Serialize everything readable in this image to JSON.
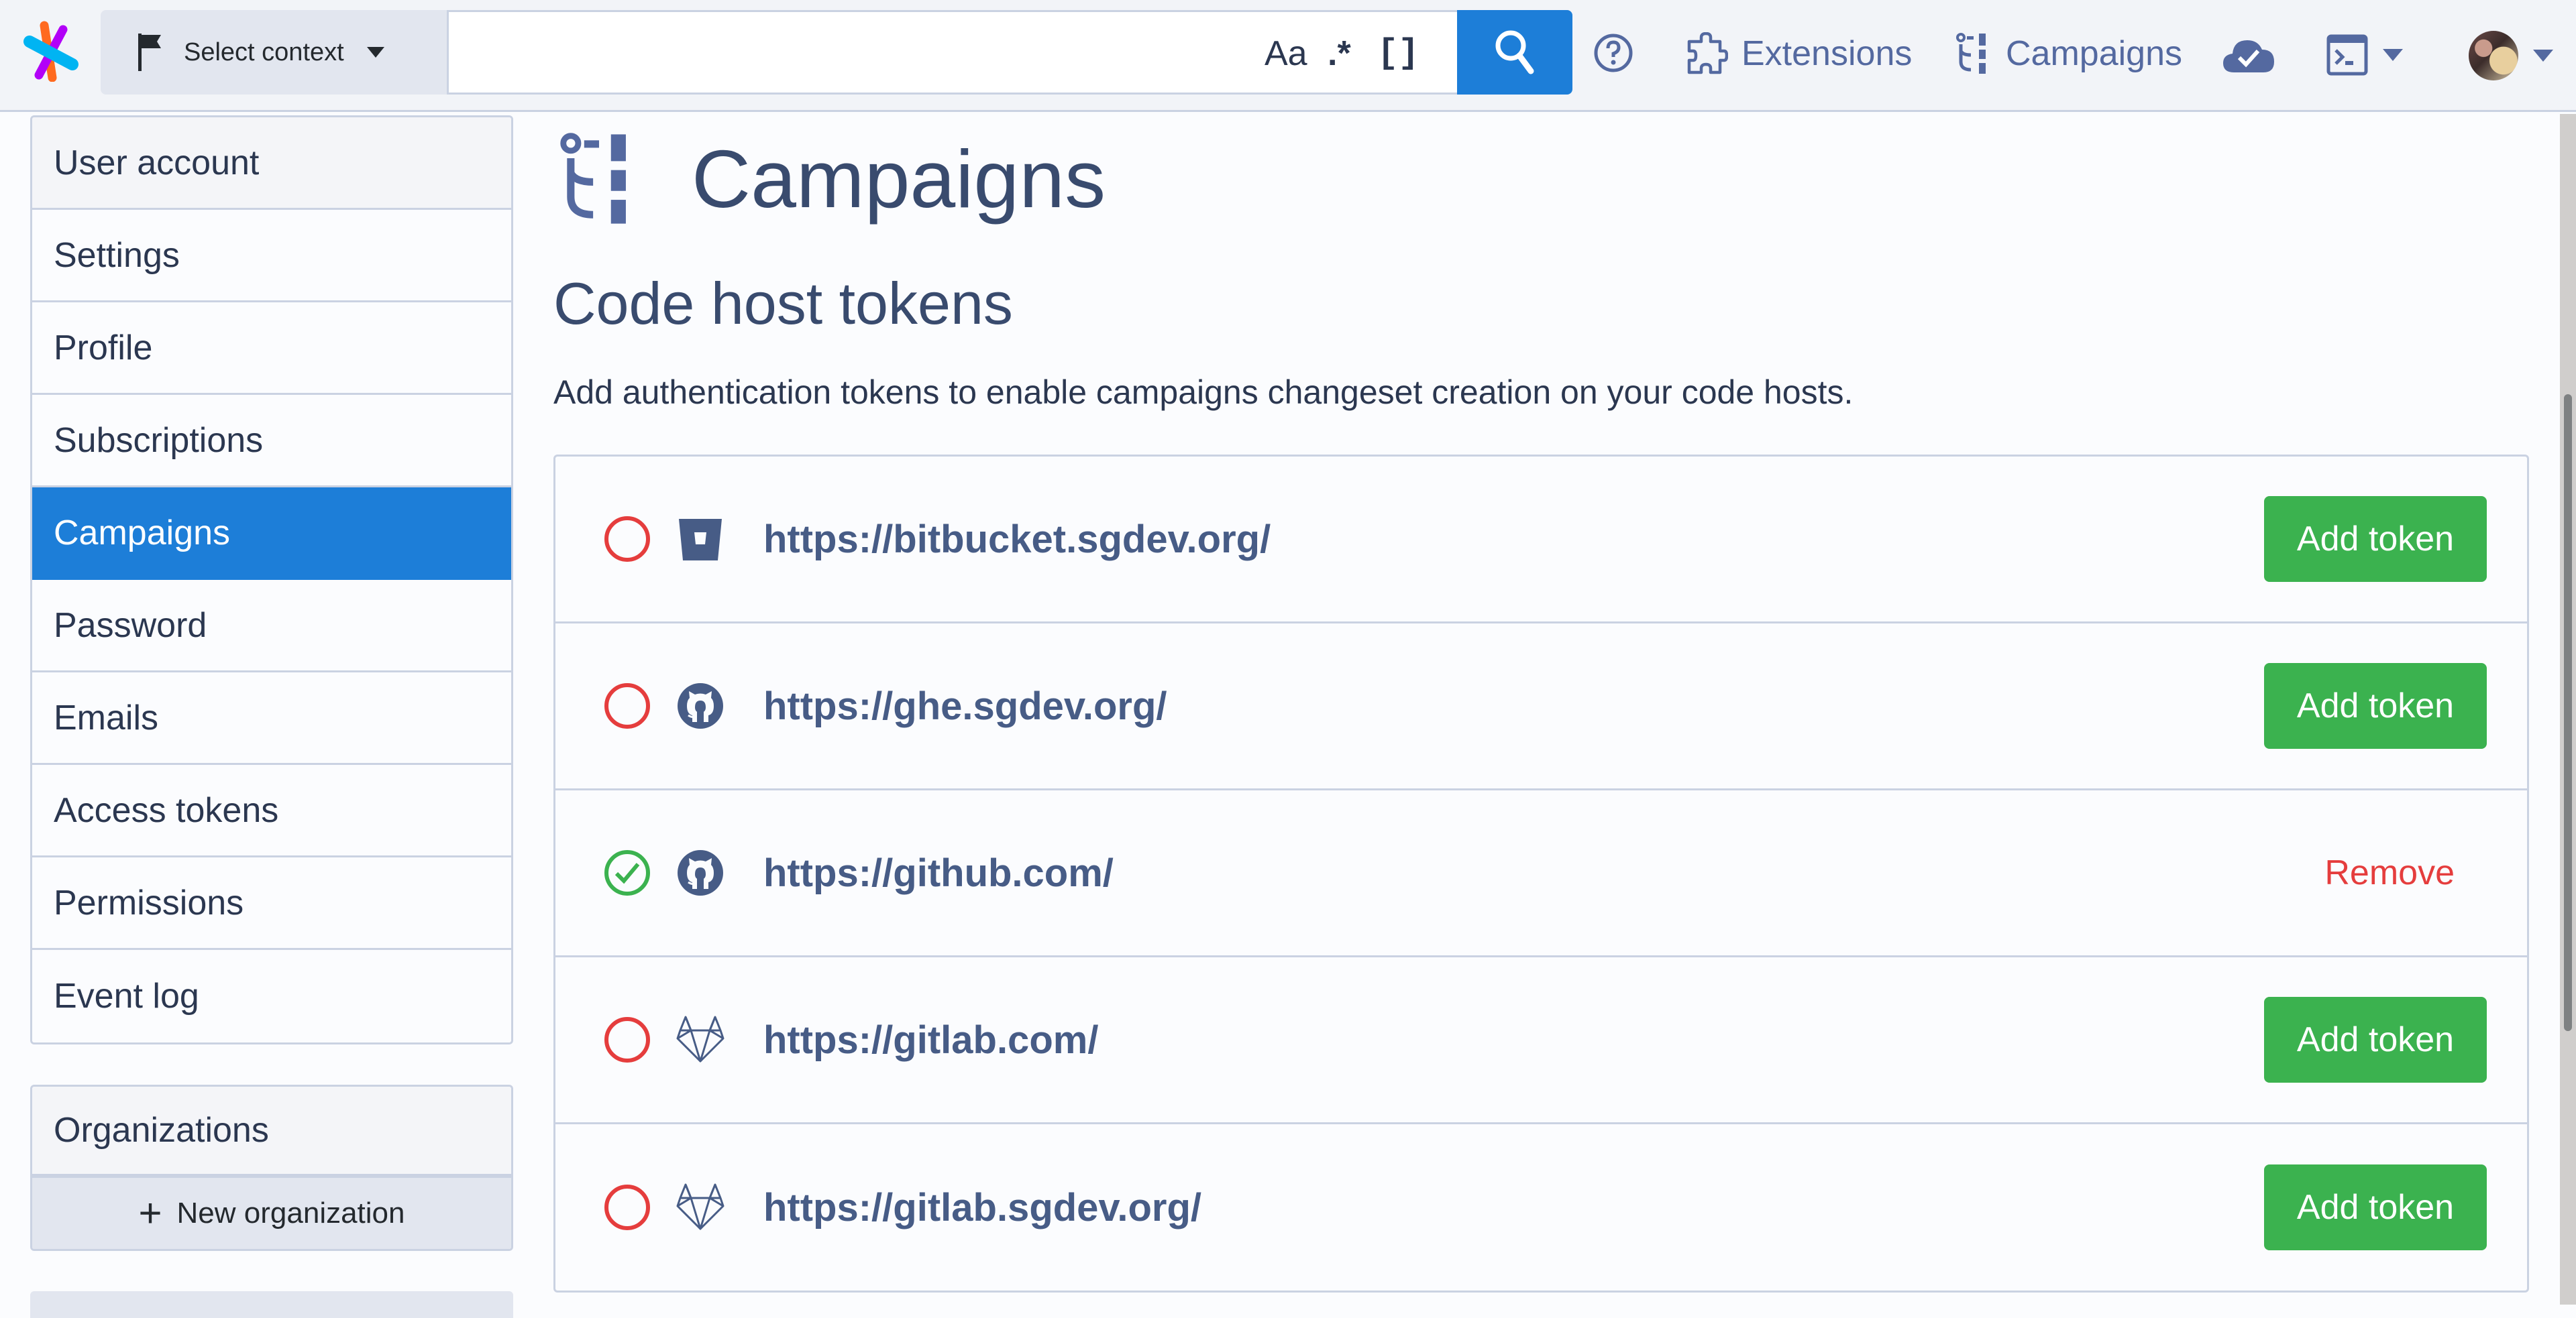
{
  "navbar": {
    "logo_icon": "sourcegraph-logo-icon",
    "context_selector": {
      "label": "Select context",
      "icon": "flag-icon"
    },
    "search": {
      "value": "",
      "placeholder": "",
      "toggles": {
        "case_sensitive": "Aa",
        "regexp": ".*",
        "structural": "[]"
      },
      "submit_icon": "search-icon"
    },
    "help_icon": "help-circle-icon",
    "links": [
      {
        "label": "Extensions",
        "icon": "puzzle-icon"
      },
      {
        "label": "Campaigns",
        "icon": "campaigns-icon"
      }
    ],
    "status_icon": "cloud-check-icon",
    "command_palette_icon": "console-icon",
    "user_avatar": "avatar"
  },
  "sidebar": {
    "user_account": {
      "header": "User account",
      "items": [
        {
          "label": "Settings",
          "active": false
        },
        {
          "label": "Profile",
          "active": false
        },
        {
          "label": "Subscriptions",
          "active": false
        },
        {
          "label": "Campaigns",
          "active": true
        },
        {
          "label": "Password",
          "active": false
        },
        {
          "label": "Emails",
          "active": false
        },
        {
          "label": "Access tokens",
          "active": false
        },
        {
          "label": "Permissions",
          "active": false
        },
        {
          "label": "Event log",
          "active": false
        }
      ]
    },
    "organizations": {
      "header": "Organizations",
      "new_button": "New organization"
    }
  },
  "main": {
    "page_title": "Campaigns",
    "section_title": "Code host tokens",
    "description": "Add authentication tokens to enable campaigns changeset creation on your code hosts.",
    "code_hosts": [
      {
        "url": "https://bitbucket.sgdev.org/",
        "kind": "bitbucket",
        "has_token": false,
        "action": "Add token"
      },
      {
        "url": "https://ghe.sgdev.org/",
        "kind": "github",
        "has_token": false,
        "action": "Add token"
      },
      {
        "url": "https://github.com/",
        "kind": "github",
        "has_token": true,
        "action": "Remove"
      },
      {
        "url": "https://gitlab.com/",
        "kind": "gitlab",
        "has_token": false,
        "action": "Add token"
      },
      {
        "url": "https://gitlab.sgdev.org/",
        "kind": "gitlab",
        "has_token": false,
        "action": "Add token"
      }
    ]
  },
  "colors": {
    "primary": "#1d7ed8",
    "success": "#3bb24f",
    "danger": "#e53d3d",
    "icon_blue": "#5469a0",
    "border": "#cad2e2"
  }
}
